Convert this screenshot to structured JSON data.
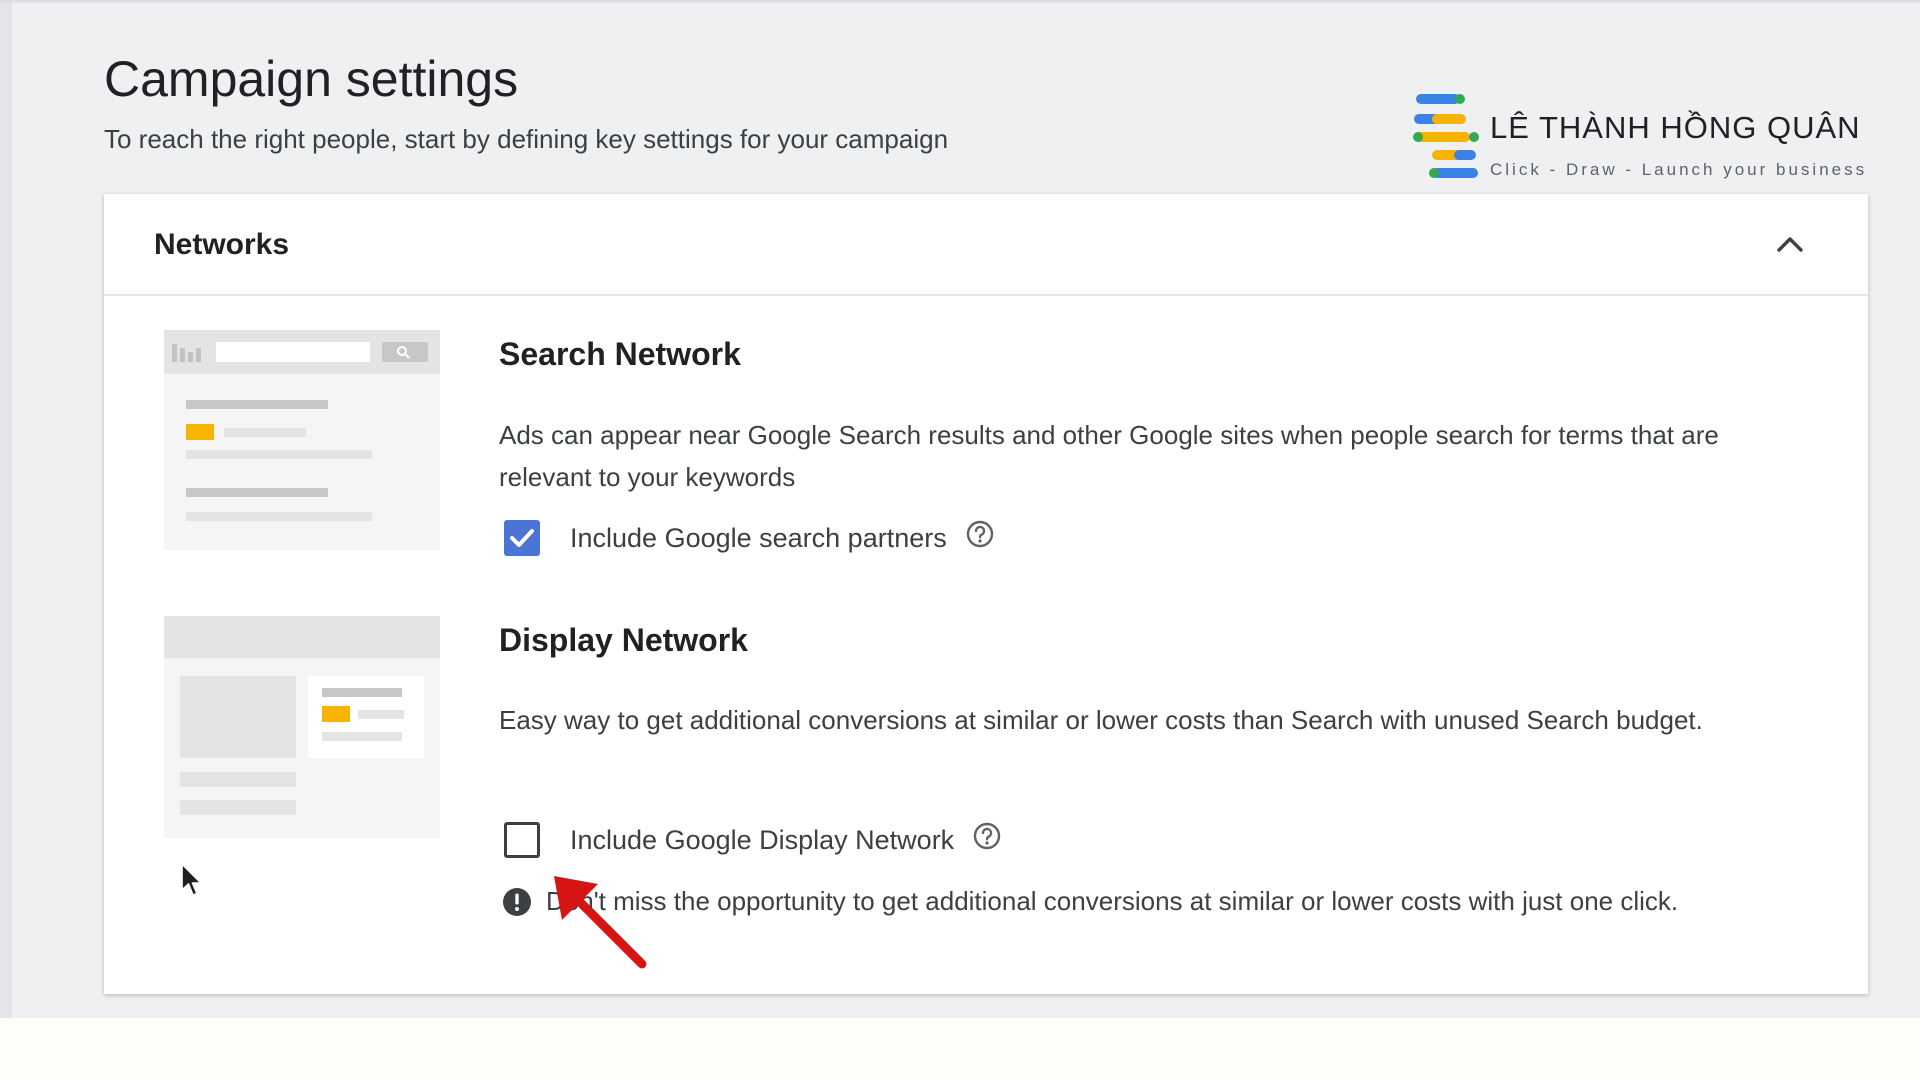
{
  "page": {
    "title": "Campaign settings",
    "subtitle": "To reach the right people, start by defining key settings for your campaign"
  },
  "watermark": {
    "name": "LÊ THÀNH HỒNG QUÂN",
    "tagline": "Click - Draw - Launch your business"
  },
  "networks": {
    "header": "Networks",
    "expanded": true,
    "search": {
      "title": "Search Network",
      "description": "Ads can appear near Google Search results and other Google sites when people search for terms that are relevant to your keywords",
      "checkbox_label": "Include Google search partners",
      "checked": true
    },
    "display": {
      "title": "Display Network",
      "description": "Easy way to get additional conversions at similar or lower costs than Search with unused Search budget.",
      "checkbox_label": "Include Google Display Network",
      "checked": false,
      "notice": "Don't miss the opportunity to get additional conversions at similar or lower costs with just one click."
    }
  },
  "icons": {
    "collapse": "chevron-up-icon",
    "help": "help-circle-icon",
    "notice": "exclamation-circle-icon",
    "check": "checkmark-icon"
  },
  "colors": {
    "checkbox_checked": "#4b74d6",
    "accent_yellow": "#f6b400",
    "annotation_arrow": "#d61414"
  }
}
